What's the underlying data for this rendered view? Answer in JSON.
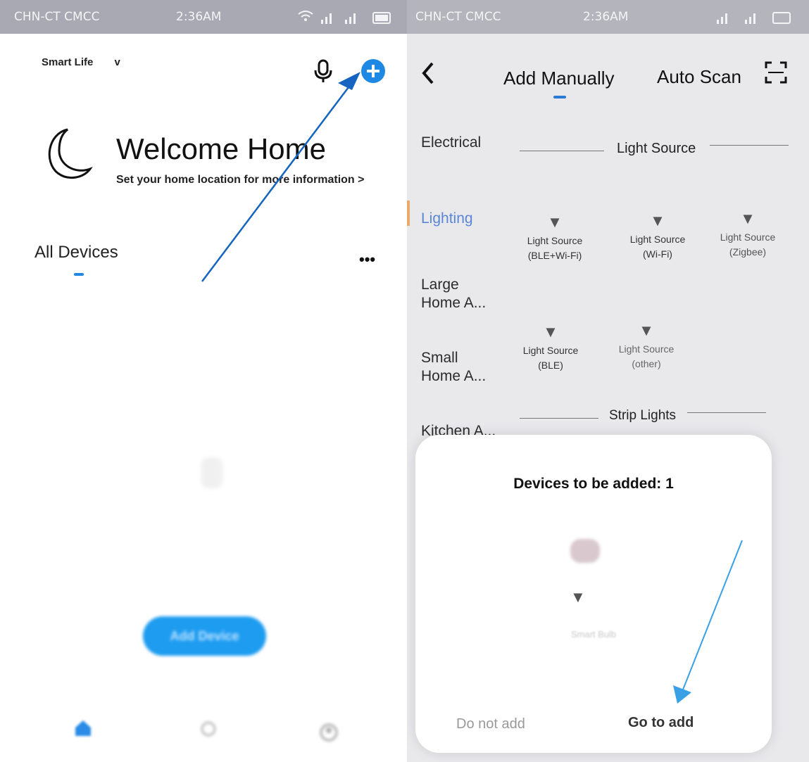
{
  "left": {
    "status_bar": {
      "carrier": "CHN-CT CMCC",
      "time": "2:36AM"
    },
    "header": {
      "app_name": "Smart Life",
      "dropdown_glyph": "v"
    },
    "welcome": {
      "title": "Welcome Home",
      "subtitle": "Set your home location for more information >"
    },
    "section": {
      "title": "All Devices",
      "more_glyph": "•••"
    },
    "add_device_button": "Add Device",
    "bottom_nav": {
      "items": [
        "home-icon",
        "scene-icon",
        "me-icon"
      ]
    },
    "colors": {
      "accent": "#1e88e5",
      "annotation_arrow": "#1565c0"
    }
  },
  "right": {
    "status_bar": {
      "carrier": "CHN-CT CMCC",
      "time": "2:36AM"
    },
    "tabs": {
      "add_manually": "Add Manually",
      "auto_scan": "Auto Scan"
    },
    "categories": [
      "Electrical",
      "Lighting",
      "Large Home A...",
      "Small Home A...",
      "Kitchen A..."
    ],
    "section_headers": {
      "light_source": "Light Source",
      "strip_lights": "Strip Lights"
    },
    "devices": [
      {
        "line1": "Light Source",
        "line2": "(BLE+Wi-Fi)"
      },
      {
        "line1": "Light Source",
        "line2": "(Wi-Fi)"
      },
      {
        "line1": "Light Source",
        "line2": "(Zigbee)"
      },
      {
        "line1": "Light Source",
        "line2": "(BLE)"
      },
      {
        "line1": "Light Source",
        "line2": "(other)"
      }
    ],
    "dialog": {
      "title": "Devices to be added: 1",
      "device_name": "Smart Bulb",
      "cancel": "Do not add",
      "confirm": "Go to add"
    },
    "colors": {
      "selected_category": "#5a86d6"
    }
  }
}
